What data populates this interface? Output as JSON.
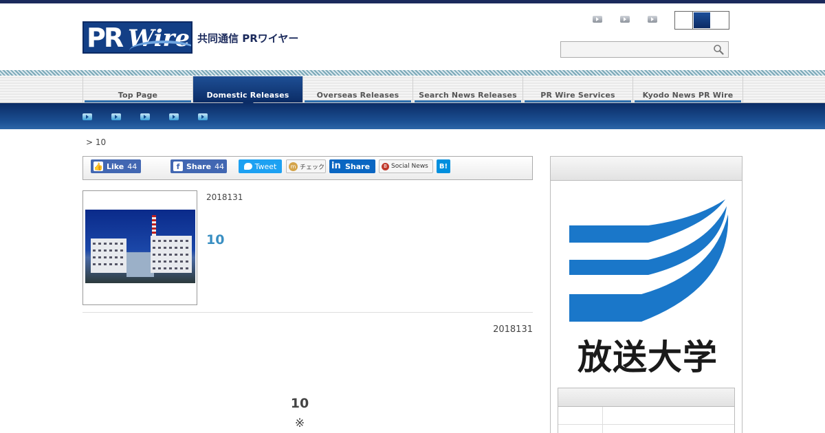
{
  "header": {
    "logo_label": "PRWire",
    "logo_pr": "PR",
    "logo_wire": "Wire",
    "logo_japanese": "共同通信 PRワイヤー",
    "utility_links": [
      "link-1",
      "link-2",
      "link-3"
    ],
    "search": {
      "value": "",
      "placeholder": ""
    }
  },
  "nav": {
    "tabs": [
      {
        "label": "Top Page",
        "active": false
      },
      {
        "label": "Domestic Releases",
        "active": true
      },
      {
        "label": "Overseas Releases",
        "active": false
      },
      {
        "label": "Search News Releases",
        "active": false
      },
      {
        "label": "PR Wire Services",
        "active": false
      },
      {
        "label": "Kyodo News PR Wire",
        "active": false
      }
    ],
    "subnav_count": 5
  },
  "breadcrumb": "> 10",
  "social": {
    "fb_like": {
      "label": "Like",
      "count": "44"
    },
    "fb_share": {
      "label": "Share",
      "count": "44"
    },
    "tweet": "Tweet",
    "mixi": "チェック",
    "linkedin": "Share",
    "social_news": "Social News",
    "hatena": "B!"
  },
  "article": {
    "date": "2018131",
    "title": "10",
    "body_date": "2018131",
    "body_heading": "10",
    "body_mark": "※"
  },
  "sidebar": {
    "org_name": "放送大学"
  },
  "colors": {
    "navy": "#0b2c66",
    "accent_blue": "#3a8fc2",
    "univ_blue": "#1a77c9"
  }
}
